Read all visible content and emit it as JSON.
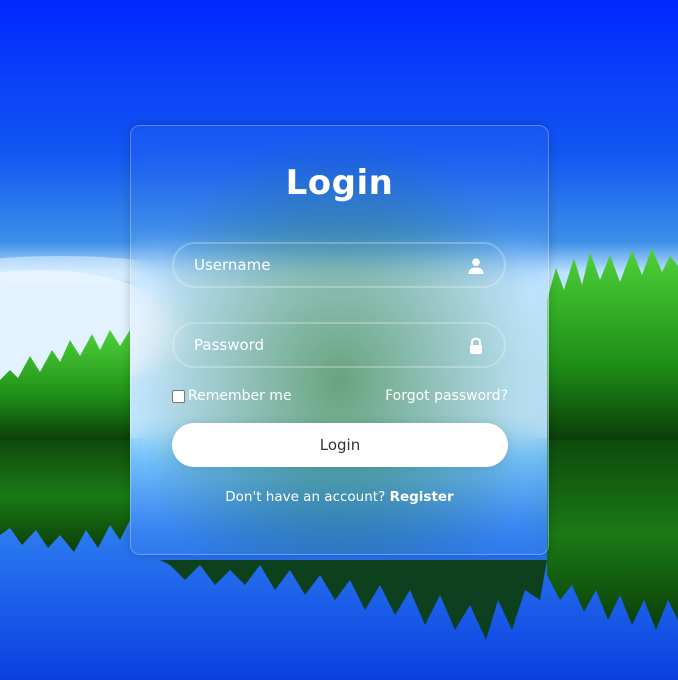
{
  "login": {
    "title": "Login",
    "username_placeholder": "Username",
    "password_placeholder": "Password",
    "remember_label": "Remember me",
    "forgot_label": "Forgot password?",
    "button_label": "Login",
    "register_prompt": "Don't have an account?",
    "register_link": "Register"
  },
  "icons": {
    "username": "user-icon",
    "password": "lock-icon"
  },
  "colors": {
    "sky_top": "#0033ff",
    "sky_mid": "#1a6cf0",
    "forest": "#1e8c1a",
    "water": "#0a4fd6",
    "text": "#ffffff",
    "button_bg": "#ffffff",
    "button_text": "#333333"
  }
}
